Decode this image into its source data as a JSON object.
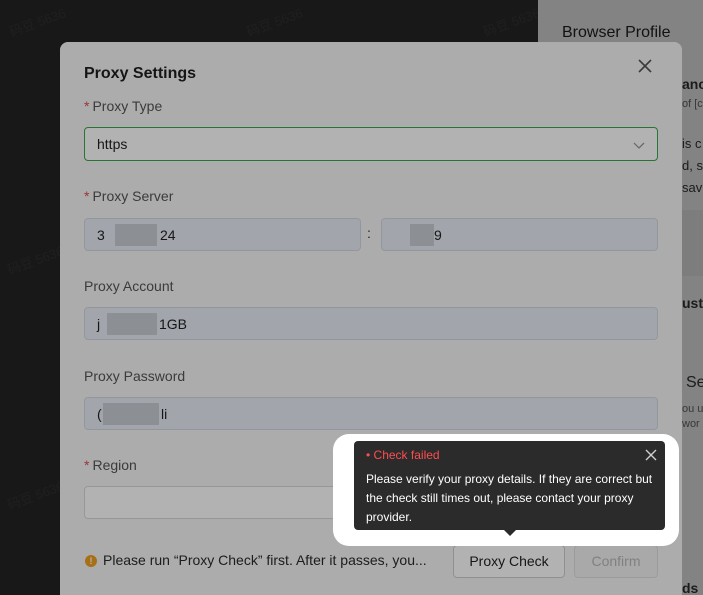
{
  "background": {
    "panel_title": "Browser Profile",
    "fragments": [
      "anc",
      "of [c",
      "is c",
      "d, st",
      "sav",
      "ust",
      "Se",
      "ou u",
      "wor",
      "ds"
    ],
    "watermarks": [
      "码豆 5636",
      "码豆 5636",
      "码豆 5636",
      "码豆 5636",
      "码豆 5636"
    ]
  },
  "dialog": {
    "title": "Proxy Settings",
    "proxy_type": {
      "label": "Proxy Type",
      "value": "https"
    },
    "proxy_server": {
      "label": "Proxy Server",
      "host_visible": "3",
      "host_visible_end": "24",
      "separator": ":",
      "port_visible_end": "9"
    },
    "proxy_account": {
      "label": "Proxy Account",
      "visible_start": "j",
      "visible_end": "1GB"
    },
    "proxy_password": {
      "label": "Proxy Password",
      "visible_start": "(",
      "visible_end": "li"
    },
    "region": {
      "label": "Region",
      "value": ""
    },
    "notice": "Please run “Proxy Check” first. After it passes, you...",
    "buttons": {
      "check": "Proxy Check",
      "confirm": "Confirm"
    }
  },
  "tooltip": {
    "status": "Check failed",
    "message": "Please verify your proxy details. If they are correct but the check still times out, please contact your proxy provider."
  },
  "colors": {
    "accent": "#3aa74a",
    "error": "#ff4d4f",
    "required": "#e14b4b",
    "warning": "#f0a020"
  },
  "icons": {
    "close": "close-icon",
    "chevron": "chevron-down-icon",
    "warning": "warning-icon"
  }
}
